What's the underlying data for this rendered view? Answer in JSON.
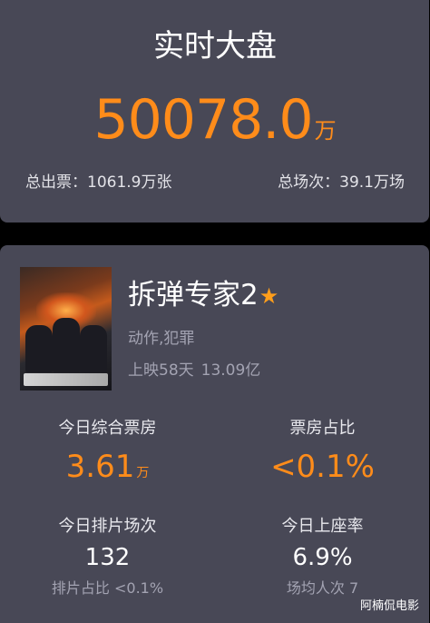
{
  "realtime": {
    "title": "实时大盘",
    "total_value": "50078.0",
    "total_unit": "万",
    "tickets": "总出票：1061.9万张",
    "shows": "总场次：39.1万场"
  },
  "movie": {
    "title": "拆弹专家2",
    "star_icon": "★",
    "genre": "动作,犯罪",
    "release_days": "上映58天",
    "total_box": "13.09亿",
    "stats": {
      "today_box_label": "今日综合票房",
      "today_box_value": "3.61",
      "today_box_unit": "万",
      "share_label": "票房占比",
      "share_value": "<0.1%",
      "schedule_label": "今日排片场次",
      "schedule_value": "132",
      "schedule_share": "排片占比 <0.1%",
      "occupancy_label": "今日上座率",
      "occupancy_value": "6.9%",
      "avg_audience": "场均人次 7"
    }
  },
  "watermark": "阿楠侃电影",
  "colors": {
    "accent": "#ff8c1a",
    "card": "#484856",
    "background": "#000000",
    "muted": "#a3a3b2"
  },
  "icons": {
    "favorite": "star-icon",
    "poster": "poster-image"
  }
}
